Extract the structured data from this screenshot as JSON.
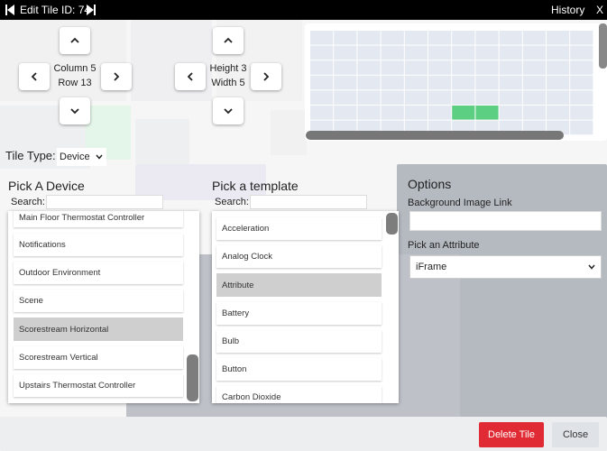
{
  "topbar": {
    "title": "Edit Tile ID: 74",
    "history_label": "History",
    "close_label": "X",
    "prev_icon": "skip-previous-icon",
    "next_icon": "skip-next-icon"
  },
  "position_pad": {
    "column_label": "Column 5",
    "row_label": "Row 13"
  },
  "size_pad": {
    "height_label": "Height 3",
    "width_label": "Width 5"
  },
  "preview_grid": {
    "columns": 10,
    "rows": 7,
    "highlight_color": "#5ccf82",
    "cell_color": "#e3e8f1"
  },
  "tile_type": {
    "label": "Tile Type:",
    "value": "Device"
  },
  "device_panel": {
    "heading": "Pick A Device",
    "search_label": "Search:",
    "search_value": "",
    "items": [
      {
        "label": "Main Floor Thermostat Controller",
        "selected": false
      },
      {
        "label": "Notifications",
        "selected": false
      },
      {
        "label": "Outdoor Environment",
        "selected": false
      },
      {
        "label": "Scene",
        "selected": false
      },
      {
        "label": "Scorestream Horizontal",
        "selected": true
      },
      {
        "label": "Scorestream Vertical",
        "selected": false
      },
      {
        "label": "Upstairs Thermostat Controller",
        "selected": false
      }
    ]
  },
  "template_panel": {
    "heading": "Pick a template",
    "search_label": "Search:",
    "search_value": "",
    "items": [
      {
        "label": "Acceleration",
        "selected": false
      },
      {
        "label": "Analog Clock",
        "selected": false
      },
      {
        "label": "Attribute",
        "selected": true
      },
      {
        "label": "Battery",
        "selected": false
      },
      {
        "label": "Bulb",
        "selected": false
      },
      {
        "label": "Button",
        "selected": false
      },
      {
        "label": "Carbon Dioxide",
        "selected": false
      }
    ]
  },
  "options_panel": {
    "heading": "Options",
    "background_label": "Background Image Link",
    "background_value": "",
    "attribute_label": "Pick an Attribute",
    "attribute_value": "iFrame"
  },
  "buttons": {
    "delete_label": "Delete Tile",
    "close_label": "Close",
    "delete_color": "#e02b34"
  }
}
